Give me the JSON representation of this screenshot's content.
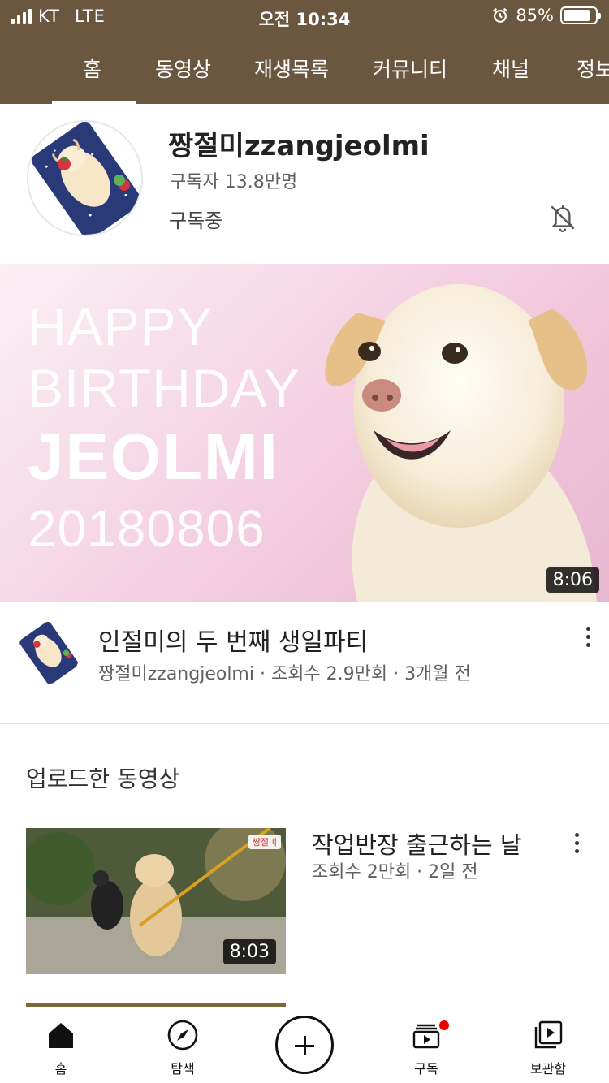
{
  "status_bar": {
    "carrier": "KT",
    "network": "LTE",
    "time": "오전 10:34",
    "battery_percent": "85%",
    "battery_level": 0.85
  },
  "tabs": [
    {
      "label": "홈",
      "active": true
    },
    {
      "label": "동영상"
    },
    {
      "label": "재생목록"
    },
    {
      "label": "커뮤니티"
    },
    {
      "label": "채널"
    },
    {
      "label": "정보"
    }
  ],
  "channel": {
    "name": "짱절미zzangjeolmi",
    "subscribers": "구독자 13.8만명",
    "subscribed_label": "구독중",
    "bell_icon": "bell-off-icon"
  },
  "featured": {
    "thumb_lines": [
      "HAPPY",
      "BIRTHDAY",
      "JEOLMI",
      "20180806"
    ],
    "duration": "8:06",
    "title": "인절미의 두 번째 생일파티",
    "meta": "짱절미zzangjeolmi · 조회수 2.9만회 · 3개월 전"
  },
  "uploads": {
    "section_title": "업로드한 동영상",
    "videos": [
      {
        "title": "작업반장 출근하는 날",
        "meta": "조회수 2만회 · 2일 전",
        "duration": "8:03",
        "watermark": "짱절미"
      }
    ]
  },
  "bottom_nav": [
    {
      "label": "홈",
      "icon": "home-icon",
      "active": true
    },
    {
      "label": "탐색",
      "icon": "compass-icon"
    },
    {
      "label": "",
      "icon": "create-icon"
    },
    {
      "label": "구독",
      "icon": "subscriptions-icon",
      "badge": true
    },
    {
      "label": "보관함",
      "icon": "library-icon"
    }
  ],
  "colors": {
    "header_bg": "#6b5740",
    "hero_bg": "#f3cde0",
    "notification_dot": "#e00000"
  }
}
